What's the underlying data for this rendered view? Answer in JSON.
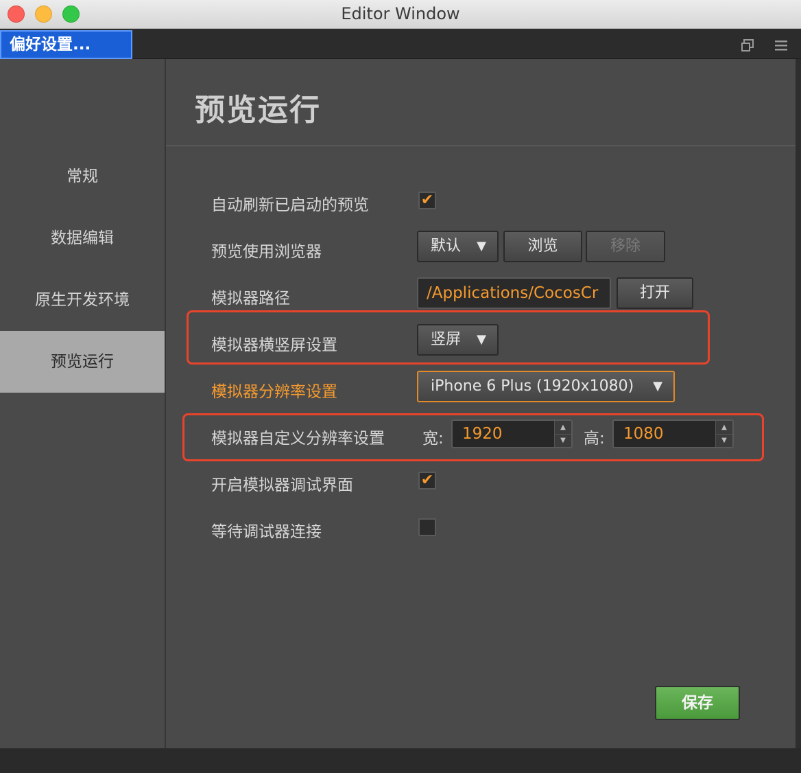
{
  "window": {
    "title": "Editor Window"
  },
  "tabs": {
    "active_label": "偏好设置...",
    "restore_icon": "restore-window-icon",
    "menu_icon": "hamburger-menu-icon"
  },
  "sidebar": {
    "items": [
      {
        "label": "常规",
        "active": false
      },
      {
        "label": "数据编辑",
        "active": false
      },
      {
        "label": "原生开发环境",
        "active": false
      },
      {
        "label": "预览运行",
        "active": true
      }
    ]
  },
  "main": {
    "title": "预览运行",
    "auto_refresh": {
      "label": "自动刷新已启动的预览",
      "checked": true,
      "check_glyph": "✔"
    },
    "browser": {
      "label": "预览使用浏览器",
      "selected": "默认",
      "browse_label": "浏览",
      "remove_label": "移除"
    },
    "simulator_path": {
      "label": "模拟器路径",
      "value": "/Applications/CocosCr",
      "open_label": "打开"
    },
    "orientation": {
      "label": "模拟器横竖屏设置",
      "selected": "竖屏"
    },
    "resolution": {
      "label": "模拟器分辨率设置",
      "selected": "iPhone 6 Plus (1920x1080)"
    },
    "custom_resolution": {
      "label": "模拟器自定义分辨率设置",
      "width_label": "宽:",
      "width_value": "1920",
      "height_label": "高:",
      "height_value": "1080"
    },
    "debug_ui": {
      "label": "开启模拟器调试界面",
      "checked": true,
      "check_glyph": "✔"
    },
    "wait_debugger": {
      "label": "等待调试器连接",
      "checked": false,
      "check_glyph": ""
    },
    "dropdown_arrow": "▼",
    "save_label": "保存"
  },
  "colors": {
    "accent_orange": "#f59a2e",
    "highlight_red": "#e8442c",
    "save_green": "#5aa84a",
    "tab_blue": "#1a5fd6"
  }
}
